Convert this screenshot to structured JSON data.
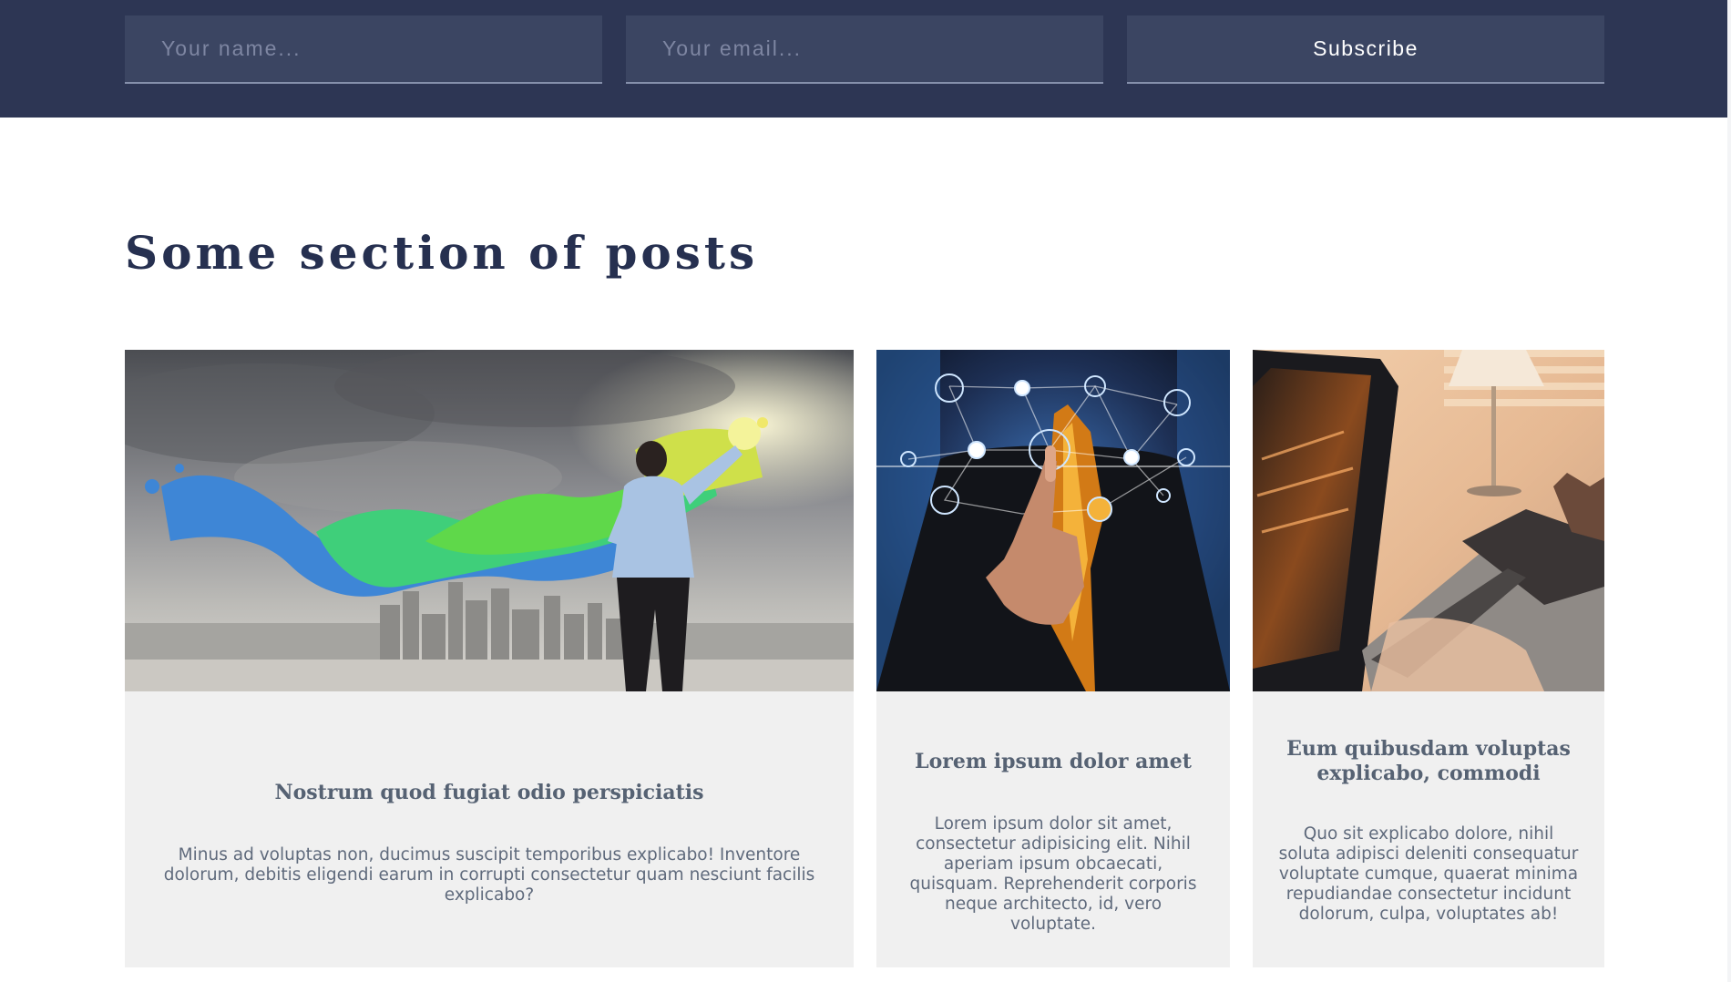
{
  "subscribe": {
    "name_placeholder": "Your name...",
    "email_placeholder": "Your email...",
    "button_label": "Subscribe"
  },
  "section": {
    "title": "Some section of posts"
  },
  "posts": [
    {
      "title": "Nostrum quod fugiat odio perspiciatis",
      "excerpt": "Minus ad voluptas non, ducimus suscipit temporibus explicabo! Inventore dolorum, debitis eligendi earum in corrupti consectetur quam nesciunt facilis explicabo?",
      "image": "man-painting-color-splash-over-city"
    },
    {
      "title": "Lorem ipsum dolor amet",
      "excerpt": "Lorem ipsum dolor sit amet, consectetur adipisicing elit. Nihil aperiam ipsum obcaecati, quisquam. Reprehenderit corporis neque architecto, id, vero voluptate.",
      "image": "businessman-touching-network-icons"
    },
    {
      "title": "Eum quibusdam voluptas explicabo, commodi",
      "excerpt": "Quo sit explicabo dolore, nihil soluta adipisci deleniti consequatur voluptate cumque, quaerat minima repudiandae consectetur incidunt dolorum, culpa, voluptates ab!",
      "image": "laptop-with-drawing-tablet"
    }
  ],
  "colors": {
    "band": "#2d3654",
    "field": "#3b4562",
    "heading": "#263050",
    "card": "#f0f0f0",
    "card_title": "#566273"
  }
}
